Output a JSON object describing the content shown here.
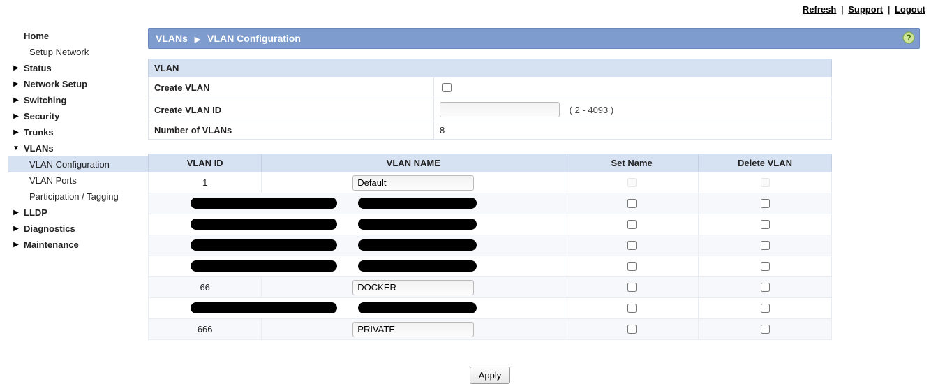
{
  "top_links": {
    "refresh": "Refresh",
    "support": "Support",
    "logout": "Logout"
  },
  "sidebar": {
    "home": "Home",
    "setup_network": "Setup Network",
    "status": "Status",
    "network_setup": "Network Setup",
    "switching": "Switching",
    "security": "Security",
    "trunks": "Trunks",
    "vlans": "VLANs",
    "vlan_configuration": "VLAN Configuration",
    "vlan_ports": "VLAN Ports",
    "participation_tagging": "Participation / Tagging",
    "lldp": "LLDP",
    "diagnostics": "Diagnostics",
    "maintenance": "Maintenance"
  },
  "breadcrumb": {
    "section": "VLANs",
    "page": "VLAN Configuration"
  },
  "form": {
    "section_title": "VLAN",
    "create_vlan_label": "Create VLAN",
    "create_vlan_id_label": "Create VLAN ID",
    "create_vlan_id_value": "",
    "create_vlan_id_hint": "( 2 - 4093 )",
    "num_vlans_label": "Number of VLANs",
    "num_vlans_value": "8"
  },
  "columns": {
    "id": "VLAN ID",
    "name": "VLAN NAME",
    "set": "Set Name",
    "del": "Delete VLAN"
  },
  "vlans": [
    {
      "id": "1",
      "name": "Default",
      "redacted": false,
      "del_disabled": true
    },
    {
      "id": "",
      "name": "",
      "redacted": true,
      "del_disabled": false
    },
    {
      "id": "",
      "name": "",
      "redacted": true,
      "del_disabled": false
    },
    {
      "id": "",
      "name": "",
      "redacted": true,
      "del_disabled": false
    },
    {
      "id": "",
      "name": "",
      "redacted": true,
      "del_disabled": false
    },
    {
      "id": "66",
      "name": "DOCKER",
      "redacted": false,
      "del_disabled": false
    },
    {
      "id": "",
      "name": "",
      "redacted": true,
      "del_disabled": false
    },
    {
      "id": "666",
      "name": "PRIVATE",
      "redacted": false,
      "del_disabled": false
    }
  ],
  "apply_label": "Apply"
}
